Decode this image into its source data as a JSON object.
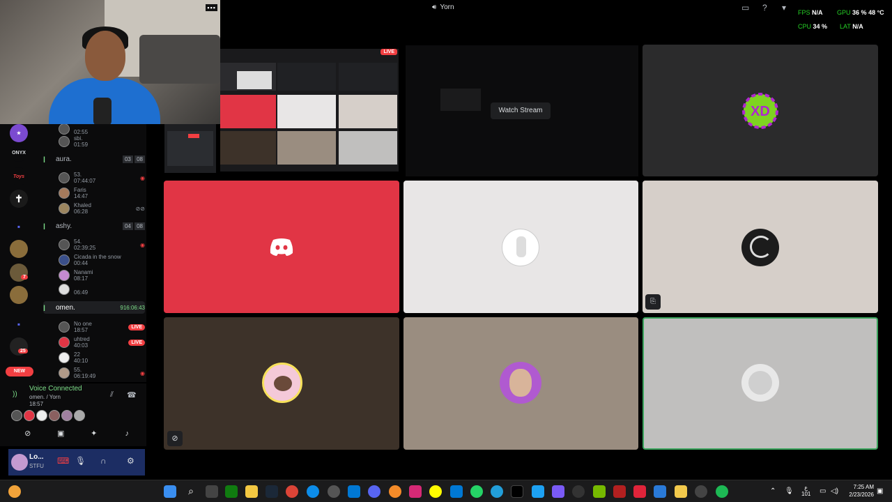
{
  "window": {
    "title": "Yorn"
  },
  "stats": {
    "fps_label": "FPS",
    "fps_value": "N/A",
    "gpu_label": "GPU",
    "gpu_value": "36 %",
    "gpu_temp": "48 °C",
    "cpu_label": "CPU",
    "cpu_value": "34 %",
    "lat_label": "LAT",
    "lat_value": "N/A"
  },
  "rail": {
    "labels": [
      "ONYX",
      "Toys"
    ],
    "badges": [
      "7",
      "25"
    ],
    "new_label": "NEW"
  },
  "channels": {
    "top_users": [
      {
        "name": "",
        "time": "02:55"
      },
      {
        "name": "sbi.",
        "time": "01:59"
      }
    ],
    "list": [
      {
        "name": "aura.",
        "count": "03",
        "limit": "08",
        "users": [
          {
            "name": "53.",
            "time": "07:44:07"
          },
          {
            "name": "Faris",
            "time": "14:47"
          },
          {
            "name": "Khaled",
            "time": "06:28"
          }
        ]
      },
      {
        "name": "ashy.",
        "count": "04",
        "limit": "08",
        "users": [
          {
            "name": "54.",
            "time": "02:39:25"
          },
          {
            "name": "Cicada in the snow",
            "time": "00:44"
          },
          {
            "name": "Nanami",
            "time": "08:17"
          },
          {
            "name": "",
            "time": "06:49"
          }
        ]
      },
      {
        "name": "omen.",
        "timer": "916:06:43",
        "users": [
          {
            "name": "No one",
            "time": "18:57",
            "live": "LIVE"
          },
          {
            "name": "uhtred",
            "time": "40:03",
            "live": "LIVE"
          },
          {
            "name": "22",
            "time": "40:10"
          },
          {
            "name": "55.",
            "time": "06:19:49"
          }
        ]
      }
    ]
  },
  "voice": {
    "status": "Voice Connected",
    "channel": "omen. / Yorn",
    "time": "18:57"
  },
  "user_panel": {
    "name": "Lo...",
    "status": "STFU"
  },
  "stream": {
    "live_label": "LIVE",
    "watch_label": "Watch Stream"
  },
  "colors": {
    "discord_red": "#e13545",
    "accent_green": "#26d126",
    "taskbar": "#1b1b1c"
  },
  "taskbar": {
    "time": "7:25 AM",
    "date": "2/23/2026",
    "kb": "ع",
    "kb2": "101",
    "badges": [
      "2",
      "4",
      "18",
      "15",
      "4"
    ]
  }
}
